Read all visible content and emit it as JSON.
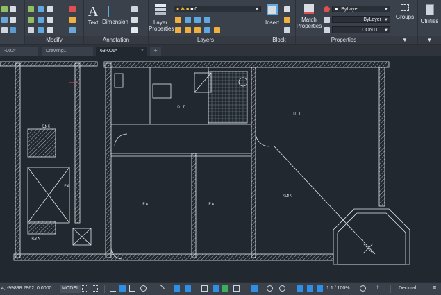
{
  "ribbon": {
    "panels": {
      "modify": "Modify",
      "annotation": "Annotation",
      "layers": "Layers",
      "block": "Block",
      "properties": "Properties",
      "groups": "Groups",
      "utilities": "Utilities"
    },
    "buttons": {
      "text": "Text",
      "dimension": "Dimension",
      "layer_properties_1": "Layer",
      "layer_properties_2": "Properties",
      "insert": "Insert",
      "match_properties_1": "Match",
      "match_properties_2": "Properties",
      "groups": "Groups",
      "utilities": "Utilities"
    },
    "layer_combo": "0",
    "props": {
      "color": "ByLayer",
      "lineweight": "ByLayer",
      "linetype": "CONTI..."
    },
    "colors": {
      "accent": "#2d8fe6",
      "lightbulb": "#f2c230",
      "sun": "#f2c230"
    }
  },
  "tabs": [
    {
      "label": "-002*"
    },
    {
      "label": "Drawing1"
    },
    {
      "label": "63-001*",
      "active": true
    }
  ],
  "tab_add": "+",
  "tab_close": "×",
  "drawing": {
    "labels": {
      "room_a": "ᴳ̶ᴺᴷ",
      "room_b": "ᴱ̶ᴬ",
      "room_c": "ᴰᴸᴰ",
      "room_d": "ᴾ̶ᴮᴬ"
    }
  },
  "status": {
    "coords": "4, -99898.2862, 0.0000",
    "model": "MODEL",
    "scale": "1:1 / 100%",
    "units": "Decimal"
  }
}
